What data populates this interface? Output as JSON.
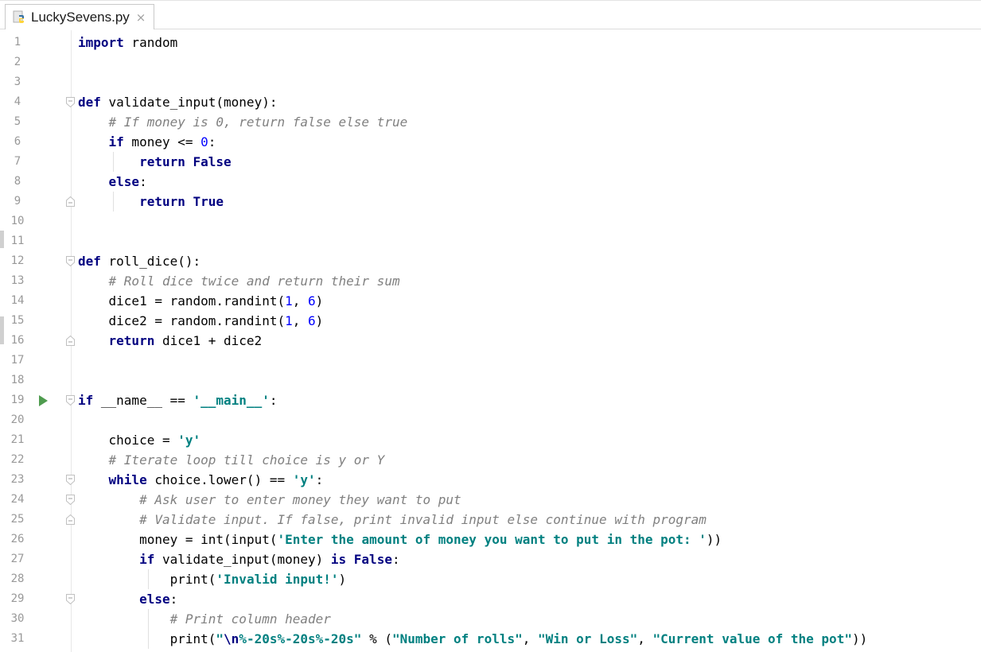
{
  "editor": {
    "tab": {
      "file_name": "LuckySevens.py",
      "close_glyph": "×",
      "icon": "python-file-icon"
    },
    "lines": [
      {
        "n": "1",
        "tokens": [
          [
            "kw",
            "import"
          ],
          [
            "t",
            " random"
          ]
        ]
      },
      {
        "n": "2",
        "tokens": []
      },
      {
        "n": "3",
        "tokens": []
      },
      {
        "n": "4",
        "fold": "open",
        "tokens": [
          [
            "kw",
            "def"
          ],
          [
            "t",
            " validate_input(money):"
          ]
        ]
      },
      {
        "n": "5",
        "tokens": [
          [
            "t",
            "    "
          ],
          [
            "cmt",
            "# If money is 0, return false else true"
          ]
        ]
      },
      {
        "n": "6",
        "tokens": [
          [
            "t",
            "    "
          ],
          [
            "kw",
            "if"
          ],
          [
            "t",
            " money <= "
          ],
          [
            "num",
            "0"
          ],
          [
            "t",
            ":"
          ]
        ]
      },
      {
        "n": "7",
        "tokens": [
          [
            "t",
            "        "
          ],
          [
            "kw",
            "return False"
          ]
        ]
      },
      {
        "n": "8",
        "tokens": [
          [
            "t",
            "    "
          ],
          [
            "kw",
            "else"
          ],
          [
            "t",
            ":"
          ]
        ]
      },
      {
        "n": "9",
        "fold": "close",
        "tokens": [
          [
            "t",
            "        "
          ],
          [
            "kw",
            "return True"
          ]
        ]
      },
      {
        "n": "10",
        "tokens": []
      },
      {
        "n": "11",
        "tokens": []
      },
      {
        "n": "12",
        "fold": "open",
        "tokens": [
          [
            "kw",
            "def"
          ],
          [
            "t",
            " roll_dice():"
          ]
        ]
      },
      {
        "n": "13",
        "tokens": [
          [
            "t",
            "    "
          ],
          [
            "cmt",
            "# Roll dice twice and return their sum"
          ]
        ]
      },
      {
        "n": "14",
        "tokens": [
          [
            "t",
            "    dice1 = random.randint("
          ],
          [
            "num",
            "1"
          ],
          [
            "t",
            ", "
          ],
          [
            "num",
            "6"
          ],
          [
            "t",
            ")"
          ]
        ]
      },
      {
        "n": "15",
        "tokens": [
          [
            "t",
            "    dice2 = random.randint("
          ],
          [
            "num",
            "1"
          ],
          [
            "t",
            ", "
          ],
          [
            "num",
            "6"
          ],
          [
            "t",
            ")"
          ]
        ]
      },
      {
        "n": "16",
        "fold": "close",
        "tokens": [
          [
            "t",
            "    "
          ],
          [
            "kw",
            "return"
          ],
          [
            "t",
            " dice1 + dice2"
          ]
        ]
      },
      {
        "n": "17",
        "tokens": []
      },
      {
        "n": "18",
        "tokens": []
      },
      {
        "n": "19",
        "fold": "open",
        "run": true,
        "tokens": [
          [
            "kw",
            "if"
          ],
          [
            "t",
            " __name__ == "
          ],
          [
            "str",
            "'__main__'"
          ],
          [
            "t",
            ":"
          ]
        ]
      },
      {
        "n": "20",
        "tokens": []
      },
      {
        "n": "21",
        "tokens": [
          [
            "t",
            "    choice = "
          ],
          [
            "str",
            "'y'"
          ]
        ]
      },
      {
        "n": "22",
        "tokens": [
          [
            "t",
            "    "
          ],
          [
            "cmt",
            "# Iterate loop till choice is y or Y"
          ]
        ]
      },
      {
        "n": "23",
        "fold": "open",
        "tokens": [
          [
            "t",
            "    "
          ],
          [
            "kw",
            "while"
          ],
          [
            "t",
            " choice.lower() == "
          ],
          [
            "str",
            "'y'"
          ],
          [
            "t",
            ":"
          ]
        ]
      },
      {
        "n": "24",
        "fold": "open",
        "tokens": [
          [
            "t",
            "        "
          ],
          [
            "cmt",
            "# Ask user to enter money they want to put"
          ]
        ]
      },
      {
        "n": "25",
        "fold": "close",
        "tokens": [
          [
            "t",
            "        "
          ],
          [
            "cmt",
            "# Validate input. If false, print invalid input else continue with program"
          ]
        ]
      },
      {
        "n": "26",
        "tokens": [
          [
            "t",
            "        money = "
          ],
          [
            "bi",
            "int"
          ],
          [
            "t",
            "("
          ],
          [
            "bi",
            "input"
          ],
          [
            "t",
            "("
          ],
          [
            "str",
            "'Enter the amount of money you want to put in the pot: '"
          ],
          [
            "t",
            "))"
          ]
        ]
      },
      {
        "n": "27",
        "tokens": [
          [
            "t",
            "        "
          ],
          [
            "kw",
            "if"
          ],
          [
            "t",
            " validate_input(money) "
          ],
          [
            "kw",
            "is False"
          ],
          [
            "t",
            ":"
          ]
        ]
      },
      {
        "n": "28",
        "tokens": [
          [
            "t",
            "            "
          ],
          [
            "bi",
            "print"
          ],
          [
            "t",
            "("
          ],
          [
            "str",
            "'Invalid input!'"
          ],
          [
            "t",
            ")"
          ]
        ]
      },
      {
        "n": "29",
        "fold": "open",
        "tokens": [
          [
            "t",
            "        "
          ],
          [
            "kw",
            "else"
          ],
          [
            "t",
            ":"
          ]
        ]
      },
      {
        "n": "30",
        "tokens": [
          [
            "t",
            "            "
          ],
          [
            "cmt",
            "# Print column header"
          ]
        ]
      },
      {
        "n": "31",
        "tokens": [
          [
            "t",
            "            "
          ],
          [
            "bi",
            "print"
          ],
          [
            "t",
            "("
          ],
          [
            "str",
            "\""
          ],
          [
            "esc",
            "\\n"
          ],
          [
            "str",
            "%-20s%-20s%-20s\""
          ],
          [
            "t",
            " % ("
          ],
          [
            "str",
            "\"Number of rolls\""
          ],
          [
            "t",
            ", "
          ],
          [
            "str",
            "\"Win or Loss\""
          ],
          [
            "t",
            ", "
          ],
          [
            "str",
            "\"Current value of the pot\""
          ],
          [
            "t",
            "))"
          ]
        ]
      }
    ]
  }
}
